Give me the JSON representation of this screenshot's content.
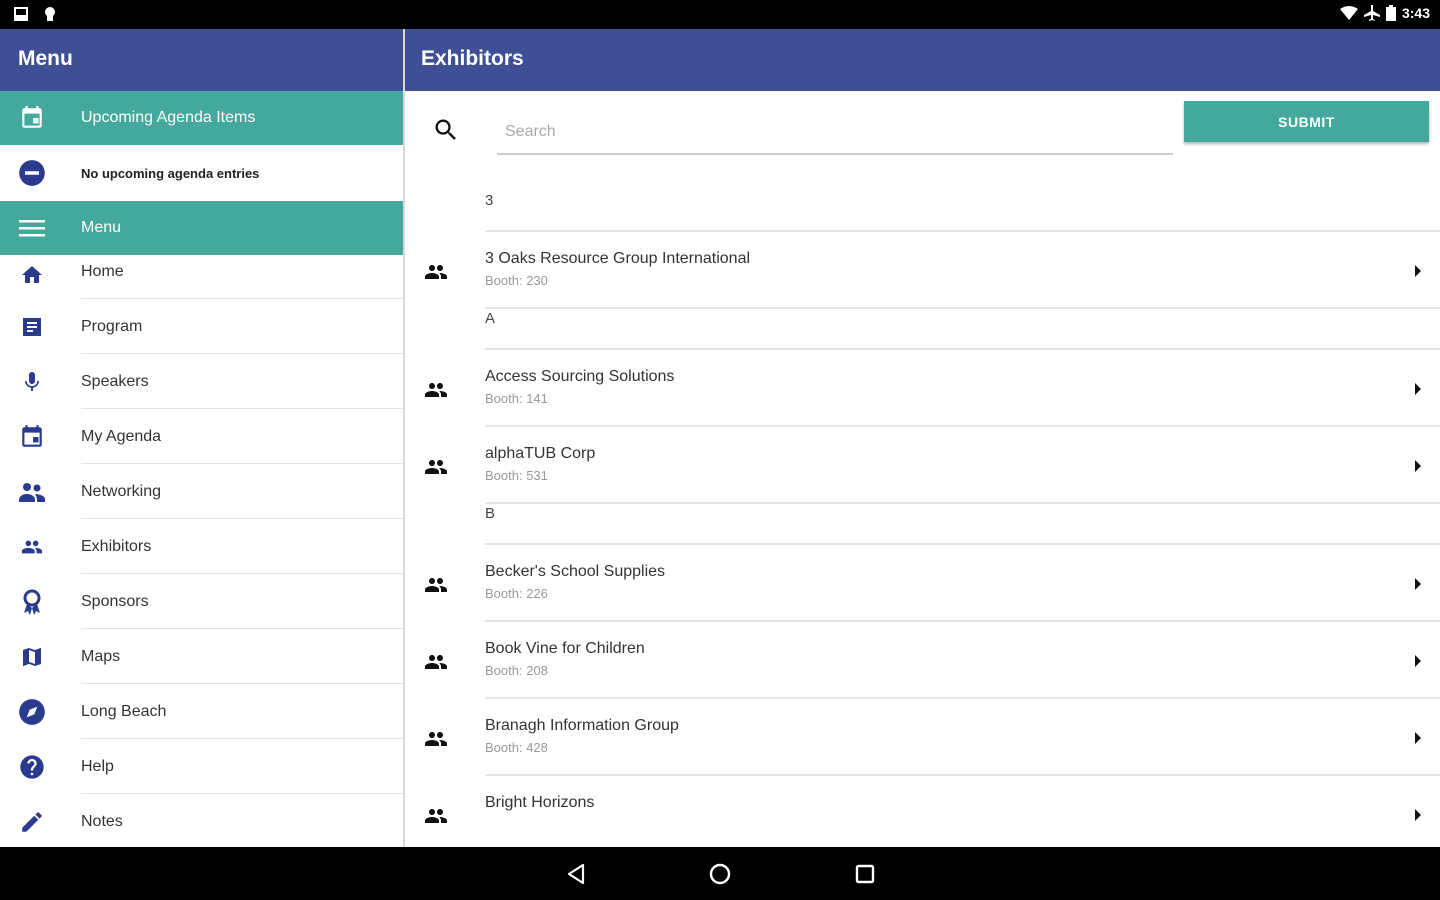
{
  "status_bar": {
    "time": "3:43"
  },
  "drawer": {
    "title": "Menu",
    "upcoming_section": "Upcoming Agenda Items",
    "no_agenda_text": "No upcoming agenda entries",
    "menu_section": "Menu",
    "items": [
      {
        "label": "Home",
        "icon": "home-icon"
      },
      {
        "label": "Program",
        "icon": "program-icon"
      },
      {
        "label": "Speakers",
        "icon": "microphone-icon"
      },
      {
        "label": "My Agenda",
        "icon": "calendar-icon"
      },
      {
        "label": "Networking",
        "icon": "networking-icon"
      },
      {
        "label": "Exhibitors",
        "icon": "people-icon"
      },
      {
        "label": "Sponsors",
        "icon": "award-icon"
      },
      {
        "label": "Maps",
        "icon": "map-icon"
      },
      {
        "label": "Long Beach",
        "icon": "compass-icon"
      },
      {
        "label": "Help",
        "icon": "help-icon"
      },
      {
        "label": "Notes",
        "icon": "pencil-icon"
      }
    ]
  },
  "main": {
    "title": "Exhibitors",
    "search_placeholder": "Search",
    "submit_label": "SUBMIT",
    "sections": [
      {
        "header": "3",
        "exhibitors": [
          {
            "name": "3 Oaks Resource Group International",
            "booth": "Booth: 230"
          }
        ]
      },
      {
        "header": "A",
        "exhibitors": [
          {
            "name": "Access Sourcing Solutions",
            "booth": "Booth: 141"
          },
          {
            "name": "alphaTUB Corp",
            "booth": "Booth: 531"
          }
        ]
      },
      {
        "header": "B",
        "exhibitors": [
          {
            "name": "Becker's School Supplies",
            "booth": "Booth: 226"
          },
          {
            "name": "Book Vine for Children",
            "booth": "Booth: 208"
          },
          {
            "name": "Branagh Information Group",
            "booth": "Booth: 428"
          },
          {
            "name": "Bright Horizons",
            "booth": ""
          }
        ]
      }
    ]
  },
  "colors": {
    "header": "#3f4f95",
    "accent": "#45a89c",
    "icon": "#2a3a8c"
  }
}
